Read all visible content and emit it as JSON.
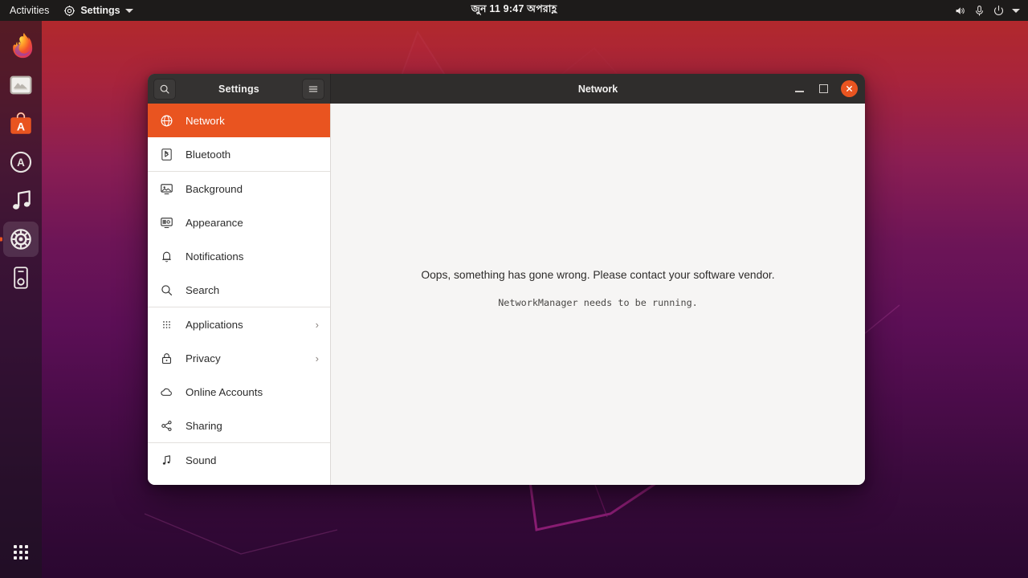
{
  "topbar": {
    "activities": "Activities",
    "app_menu": {
      "label": "Settings",
      "icon": "settings-gear-icon"
    },
    "clock": "জুন 11  9:47 অপরাহ্ণ",
    "status_icons": [
      "volume-icon",
      "microphone-icon",
      "power-icon",
      "chevron-down-icon"
    ]
  },
  "dock": {
    "items": [
      {
        "name": "firefox",
        "label": "Firefox",
        "active": false
      },
      {
        "name": "files",
        "label": "Files",
        "active": false
      },
      {
        "name": "ubuntu-software",
        "label": "Ubuntu Software",
        "active": false
      },
      {
        "name": "software-updater",
        "label": "Software Updater",
        "active": false
      },
      {
        "name": "rhythmbox",
        "label": "Rhythmbox",
        "active": false
      },
      {
        "name": "settings",
        "label": "Settings",
        "active": true
      },
      {
        "name": "help",
        "label": "Help",
        "active": false
      }
    ],
    "show_applications": "Show Applications"
  },
  "window": {
    "sidebar_title": "Settings",
    "title": "Network",
    "search_icon": "search-icon",
    "menu_icon": "hamburger-menu-icon",
    "controls": {
      "minimize": "minimize-button",
      "maximize": "maximize-button",
      "close": "close-button"
    },
    "accent_color": "#e95420",
    "sidebar": {
      "items": [
        {
          "label": "Network",
          "icon": "globe-icon",
          "selected": true,
          "chevron": ""
        },
        {
          "label": "Bluetooth",
          "icon": "bluetooth-icon",
          "selected": false,
          "chevron": ""
        },
        {
          "label": "Background",
          "icon": "background-icon",
          "selected": false,
          "chevron": ""
        },
        {
          "label": "Appearance",
          "icon": "appearance-icon",
          "selected": false,
          "chevron": ""
        },
        {
          "label": "Notifications",
          "icon": "bell-icon",
          "selected": false,
          "chevron": ""
        },
        {
          "label": "Search",
          "icon": "search-icon",
          "selected": false,
          "chevron": ""
        },
        {
          "label": "Applications",
          "icon": "apps-grid-icon",
          "selected": false,
          "chevron": "›"
        },
        {
          "label": "Privacy",
          "icon": "lock-icon",
          "selected": false,
          "chevron": "›"
        },
        {
          "label": "Online Accounts",
          "icon": "cloud-icon",
          "selected": false,
          "chevron": ""
        },
        {
          "label": "Sharing",
          "icon": "share-icon",
          "selected": false,
          "chevron": ""
        },
        {
          "label": "Sound",
          "icon": "music-note-icon",
          "selected": false,
          "chevron": ""
        }
      ]
    },
    "content": {
      "error_title": "Oops, something has gone wrong. Please contact your software vendor.",
      "error_detail": "NetworkManager needs to be running."
    }
  }
}
